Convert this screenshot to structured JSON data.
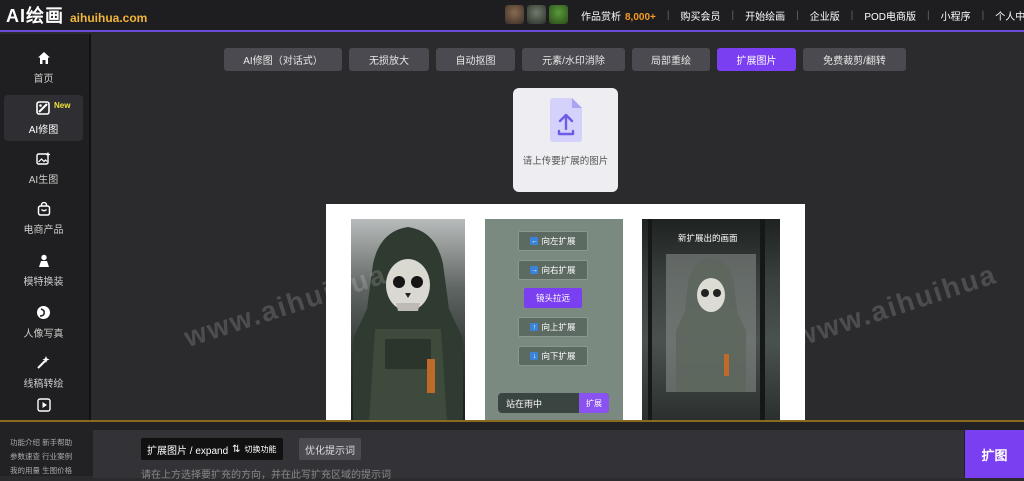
{
  "header": {
    "logo_text": "AI绘画",
    "logo_domain": "aihuihua.com",
    "nav": [
      {
        "label": "作品赏析",
        "count": "8,000+"
      },
      {
        "label": "购买会员"
      },
      {
        "label": "开始绘画"
      },
      {
        "label": "企业版"
      },
      {
        "label": "POD电商版"
      },
      {
        "label": "小程序"
      },
      {
        "label": "个人中心"
      }
    ]
  },
  "sidebar": {
    "items": [
      {
        "label": "首页",
        "icon": "home-icon"
      },
      {
        "label": "AI修图",
        "icon": "edit-image-icon",
        "badge": "New",
        "active": true
      },
      {
        "label": "AI生图",
        "icon": "image-plus-icon"
      },
      {
        "label": "电商产品",
        "icon": "shopping-bag-icon"
      },
      {
        "label": "模特换装",
        "icon": "person-icon"
      },
      {
        "label": "人像写真",
        "icon": "portrait-icon"
      },
      {
        "label": "线稿转绘",
        "icon": "sparkle-icon"
      },
      {
        "label": "",
        "icon": "video-icon"
      }
    ]
  },
  "tabs": [
    {
      "label": "AI修图（对话式）"
    },
    {
      "label": "无损放大"
    },
    {
      "label": "自动抠图"
    },
    {
      "label": "元素/水印消除"
    },
    {
      "label": "局部重绘"
    },
    {
      "label": "扩展图片",
      "active": true
    },
    {
      "label": "免费裁剪/翻转"
    }
  ],
  "upload": {
    "label": "请上传要扩展的图片",
    "icon": "upload-file-icon"
  },
  "demo": {
    "buttons": [
      {
        "label": "向左扩展",
        "arrow": "←"
      },
      {
        "label": "向右扩展",
        "arrow": "→"
      },
      {
        "label": "镜头拉远",
        "arrow": ""
      },
      {
        "label": "向上扩展",
        "arrow": "↑"
      },
      {
        "label": "向下扩展",
        "arrow": "↓"
      }
    ],
    "prompt_text": "站在雨中",
    "prompt_button": "扩展",
    "result_label": "新扩展出的画面",
    "watermark": "www.aihuihua"
  },
  "footer": {
    "links": [
      "功能介绍",
      "新手帮助",
      "参数速查",
      "行业案例",
      "我的用量",
      "生图价格"
    ],
    "mode_label": "扩展图片 / expand",
    "mode_switch": "切换功能",
    "optimize_label": "优化提示词",
    "prompt_placeholder": "请在上方选择要扩充的方向，并在此写扩充区域的提示词",
    "submit_label": "扩图"
  },
  "colors": {
    "accent": "#7b3ff2",
    "count": "#f59a23",
    "domain": "#f2b53a",
    "badge": "#f2e23a"
  }
}
